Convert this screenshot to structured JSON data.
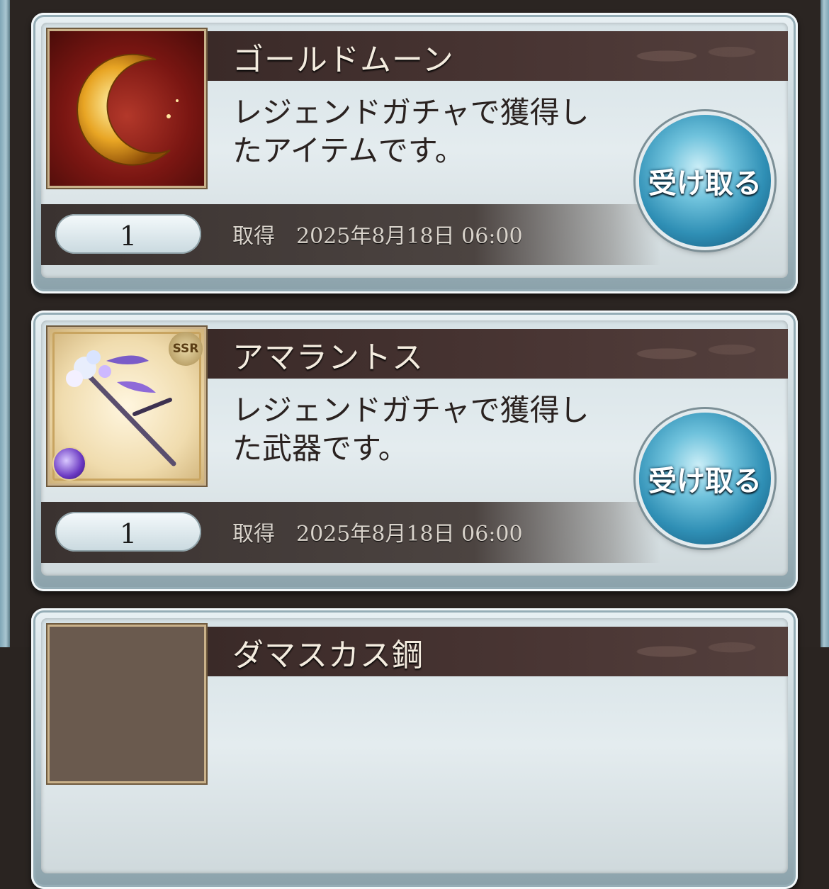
{
  "items": [
    {
      "name": "ゴールドムーン",
      "description_lines": [
        "レジェンドガチャで獲得し",
        "たアイテムです。"
      ],
      "count": "1",
      "acquired_label": "取得　2025年8月18日 06:00",
      "receive_label": "受け取る",
      "icon": "gold-moon-icon"
    },
    {
      "name": "アマラントス",
      "description_lines": [
        "レジェンドガチャで獲得し",
        "た武器です。"
      ],
      "count": "1",
      "acquired_label": "取得　2025年8月18日 06:00",
      "receive_label": "受け取る",
      "icon": "amaranthus-weapon-icon",
      "rarity": "SSR"
    },
    {
      "name": "ダマスカス鋼",
      "icon": "damascus-steel-icon"
    }
  ]
}
